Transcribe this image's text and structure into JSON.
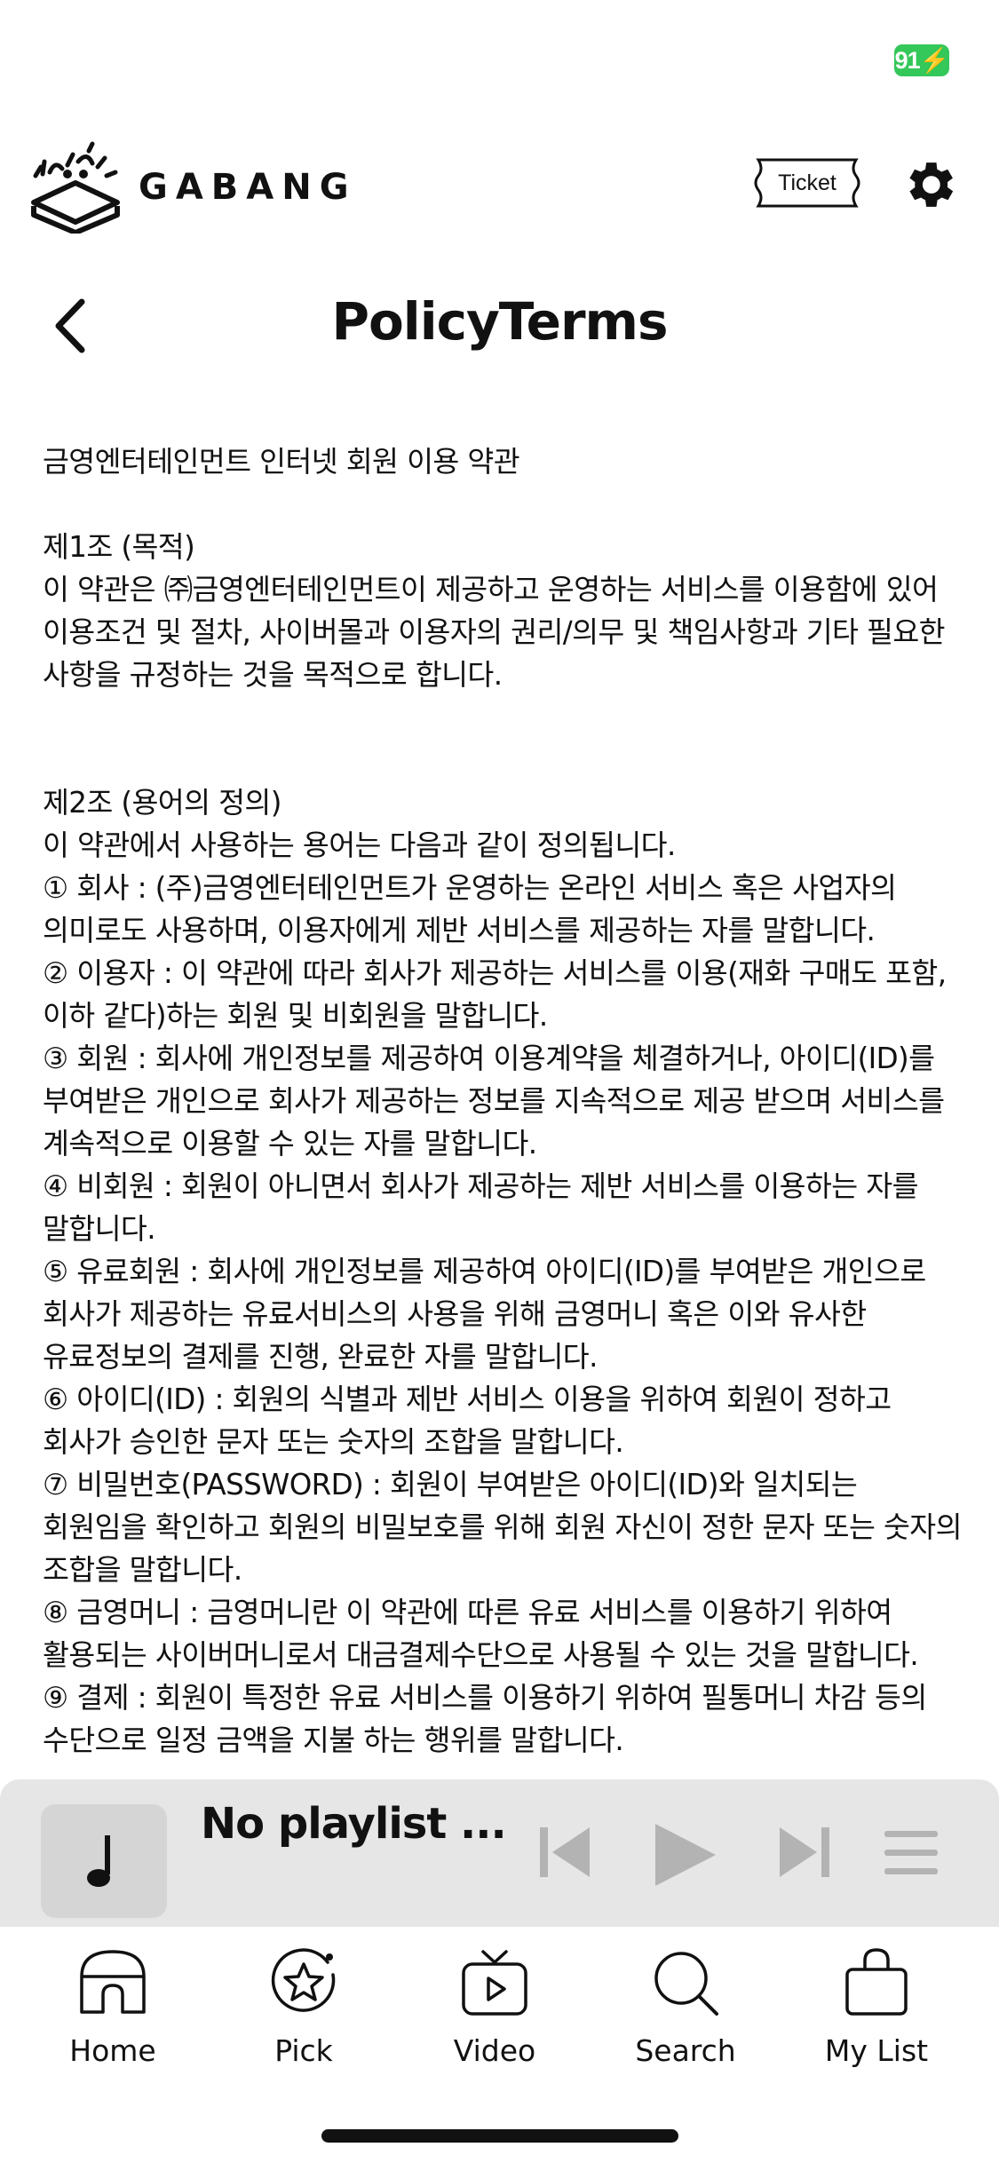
{
  "status_bar": {
    "battery": "91"
  },
  "header": {
    "logo_text": "GABANG",
    "ticket_label": "Ticket"
  },
  "page": {
    "title": "PolicyTerms"
  },
  "terms": {
    "body": "금영엔터테인먼트 인터넷 회원 이용 약관\n\n제1조 (목적)\n이 약관은 ㈜금영엔터테인먼트이 제공하고 운영하는 서비스를 이용함에 있어 이용조건 및 절차, 사이버몰과 이용자의 권리/의무 및 책임사항과 기타 필요한 사항을 규정하는 것을 목적으로 합니다.\n\n\n제2조 (용어의 정의)\n이 약관에서 사용하는 용어는 다음과 같이 정의됩니다.\n① 회사 : (주)금영엔터테인먼트가 운영하는 온라인 서비스 혹은 사업자의 의미로도 사용하며, 이용자에게 제반 서비스를 제공하는 자를 말합니다.\n② 이용자 : 이 약관에 따라 회사가 제공하는 서비스를 이용(재화 구매도 포함, 이하 같다)하는 회원 및 비회원을 말합니다.\n③ 회원 : 회사에 개인정보를 제공하여 이용계약을 체결하거나, 아이디(ID)를 부여받은 개인으로 회사가 제공하는 정보를 지속적으로 제공 받으며 서비스를 계속적으로 이용할 수 있는 자를 말합니다.\n④ 비회원 : 회원이 아니면서 회사가 제공하는 제반 서비스를 이용하는 자를 말합니다.\n⑤ 유료회원 : 회사에 개인정보를 제공하여 아이디(ID)를 부여받은 개인으로 회사가 제공하는 유료서비스의 사용을 위해 금영머니 혹은 이와 유사한 유료정보의 결제를 진행, 완료한 자를 말합니다.\n⑥ 아이디(ID) : 회원의 식별과 제반 서비스 이용을 위하여 회원이 정하고 회사가 승인한 문자 또는 숫자의 조합을 말합니다.\n⑦ 비밀번호(PASSWORD) : 회원이 부여받은 아이디(ID)와 일치되는 회원임을 확인하고 회원의 비밀보호를 위해 회원 자신이 정한 문자 또는 숫자의 조합을 말합니다.\n⑧ 금영머니 : 금영머니란 이 약관에 따른 유료 서비스를 이용하기 위하여 활용되는 사이버머니로서 대금결제수단으로 사용될 수 있는 것을 말합니다.\n⑨ 결제 : 회원이 특정한 유료 서비스를 이용하기 위하여 필통머니 차감 등의 수단으로 일정 금액을 지불 하는 행위를 말합니다."
  },
  "player": {
    "track_title": "No playlist ..."
  },
  "tabs": [
    {
      "label": "Home",
      "icon": "home-icon"
    },
    {
      "label": "Pick",
      "icon": "star-badge-icon"
    },
    {
      "label": "Video",
      "icon": "tv-play-icon"
    },
    {
      "label": "Search",
      "icon": "search-icon"
    },
    {
      "label": "My List",
      "icon": "bag-icon"
    }
  ],
  "colors": {
    "battery": "#34c759",
    "player_bg": "#e6e6e6",
    "player_controls": "#b3b3b3"
  }
}
